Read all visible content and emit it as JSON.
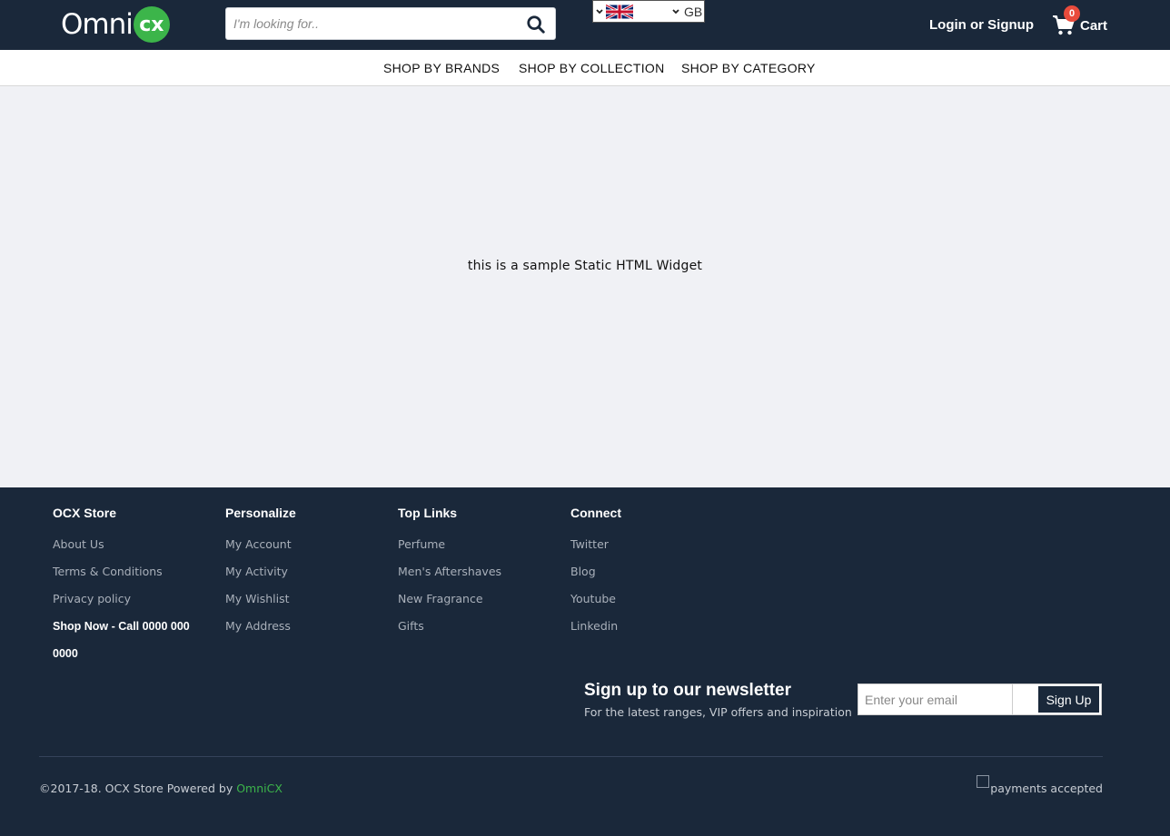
{
  "header": {
    "logo_text": "Omni",
    "logo_badge": "cx",
    "search_placeholder": "I'm looking for..",
    "country_code": "GB",
    "login_label": "Login or Signup",
    "cart_count": "0",
    "cart_label": "Cart",
    "search_icon": "search-icon",
    "cart_icon": "shopping-cart-icon"
  },
  "nav": {
    "items": [
      {
        "label": "SHOP BY BRANDS"
      },
      {
        "label": "SHOP BY COLLECTION"
      },
      {
        "label": "SHOP BY CATEGORY"
      }
    ]
  },
  "main": {
    "widget_text": "this is a sample Static HTML Widget"
  },
  "footer": {
    "columns": [
      {
        "heading": "OCX Store",
        "links": [
          "About Us",
          "Terms & Conditions",
          "Privacy policy"
        ],
        "extra": "Shop Now - Call 0000 000 0000"
      },
      {
        "heading": "Personalize",
        "links": [
          "My Account",
          "My Activity",
          "My Wishlist",
          "My Address"
        ]
      },
      {
        "heading": "Top Links",
        "links": [
          "Perfume",
          "Men's Aftershaves",
          "New Fragrance",
          "Gifts"
        ]
      },
      {
        "heading": "Connect",
        "links": [
          "Twitter",
          "Blog",
          "Youtube",
          "Linkedin"
        ]
      }
    ],
    "newsletter": {
      "title": "Sign up to our newsletter",
      "subtitle": "For the latest ranges, VIP offers and inspiration",
      "email_placeholder": "Enter your email",
      "button_label": "Sign Up"
    },
    "copyright_prefix": "©2017-18. OCX Store Powered by ",
    "copyright_brand": "OmniCX",
    "payments_alt": "payments accepted"
  },
  "colors": {
    "header_bg": "#1a283a",
    "brand_green": "#3cb54a",
    "badge_red": "#e94b3c",
    "page_bg": "#f0f1f5"
  }
}
